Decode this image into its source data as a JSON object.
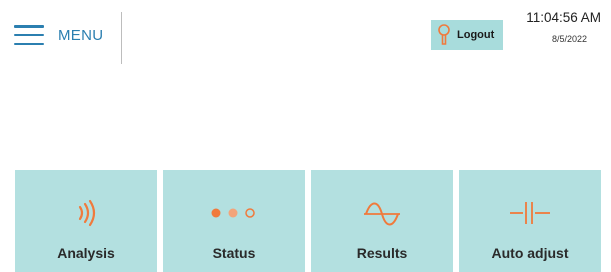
{
  "header": {
    "menu_label": "MENU",
    "logout_label": "Logout",
    "time": "11:04:56 AM",
    "date": "8/5/2022"
  },
  "colors": {
    "accent_blue": "#2b7fb0",
    "tile_bg": "#b3e0e0",
    "logout_bg": "#a8dcdc",
    "icon_orange": "#f07a3c"
  },
  "tiles": [
    {
      "label": "Analysis",
      "icon": "sound-waves-icon"
    },
    {
      "label": "Status",
      "icon": "dots-status-icon"
    },
    {
      "label": "Results",
      "icon": "sine-wave-icon"
    },
    {
      "label": "Auto adjust",
      "icon": "capacitor-icon"
    }
  ]
}
